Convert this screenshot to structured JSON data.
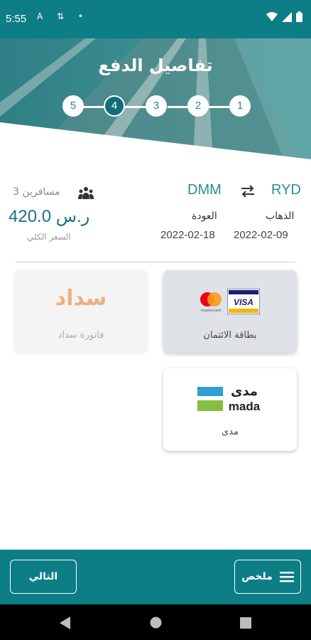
{
  "status_bar": {
    "time": "5:55",
    "notification_glyphs": "A ⇅ •"
  },
  "header": {
    "title": "تفاصيل الدفع"
  },
  "stepper": {
    "steps": [
      "5",
      "4",
      "3",
      "2",
      "1"
    ],
    "active_step": "4"
  },
  "trip": {
    "origin": "RYD",
    "destination": "DMM",
    "departure_label": "الذهاب",
    "departure_date": "2022-02-09",
    "return_label": "العودة",
    "return_date": "2022-02-18",
    "passengers": "3 مسافرين",
    "total_price": "420.0 ر.س",
    "total_price_label": "السعر الكلي"
  },
  "payment_methods": {
    "credit_card": {
      "label": "بطاقة الائتمان",
      "visa_text": "VISA",
      "mastercard_text": "mastercard"
    },
    "sadad": {
      "label": "فاتورة سداد",
      "logo_text": "سداد"
    },
    "mada": {
      "label": "مدى",
      "logo_ar": "مدى",
      "logo_en": "mada"
    }
  },
  "bottom_bar": {
    "summary_label": "ملخص",
    "next_label": "التالي"
  },
  "colors": {
    "primary": "#0d7d86",
    "accent": "#2a8c95",
    "price": "#1b6e8c",
    "sadad": "#f0a36b",
    "mada_blue": "#2f9fd6",
    "mada_green": "#84bf41"
  },
  "icons": [
    "wifi-icon",
    "signal-icon",
    "battery-icon",
    "swap-icon",
    "people-icon",
    "menu-icon",
    "back-icon",
    "home-icon",
    "recents-icon"
  ]
}
